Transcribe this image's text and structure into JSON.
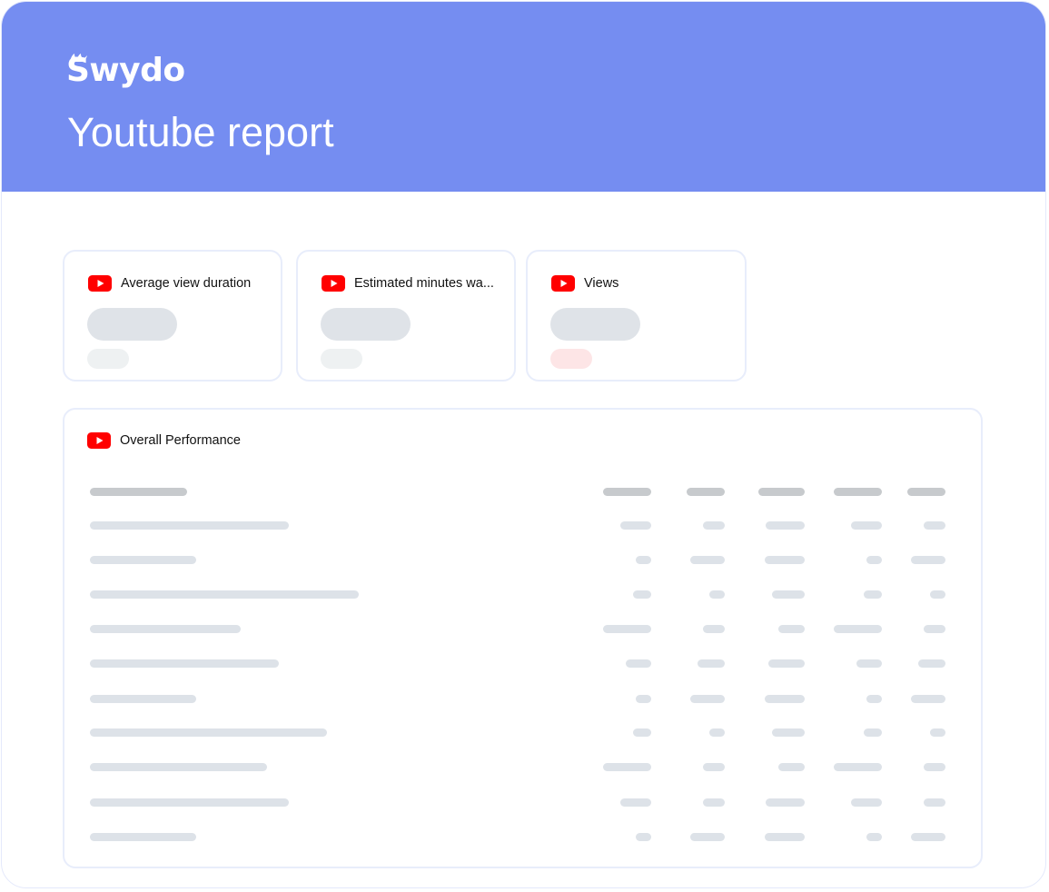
{
  "brand": {
    "logo_text": "Swydo",
    "header_color": "#758df1"
  },
  "report": {
    "title": "Youtube report"
  },
  "kpi_cards": [
    {
      "label": "Average view duration",
      "icon": "youtube-icon",
      "trend": "neutral"
    },
    {
      "label": "Estimated minutes wa...",
      "icon": "youtube-icon",
      "trend": "neutral"
    },
    {
      "label": "Views",
      "icon": "youtube-icon",
      "trend": "negative"
    }
  ],
  "table": {
    "title": "Overall Performance",
    "icon": "youtube-icon",
    "loading": true,
    "column_count": 5,
    "row_count": 10
  },
  "colors": {
    "youtube_red": "#ff0000",
    "skeleton": "#dfe3e8",
    "skeleton_header": "#c7cacd",
    "skeleton_negative": "#fde5e6"
  }
}
